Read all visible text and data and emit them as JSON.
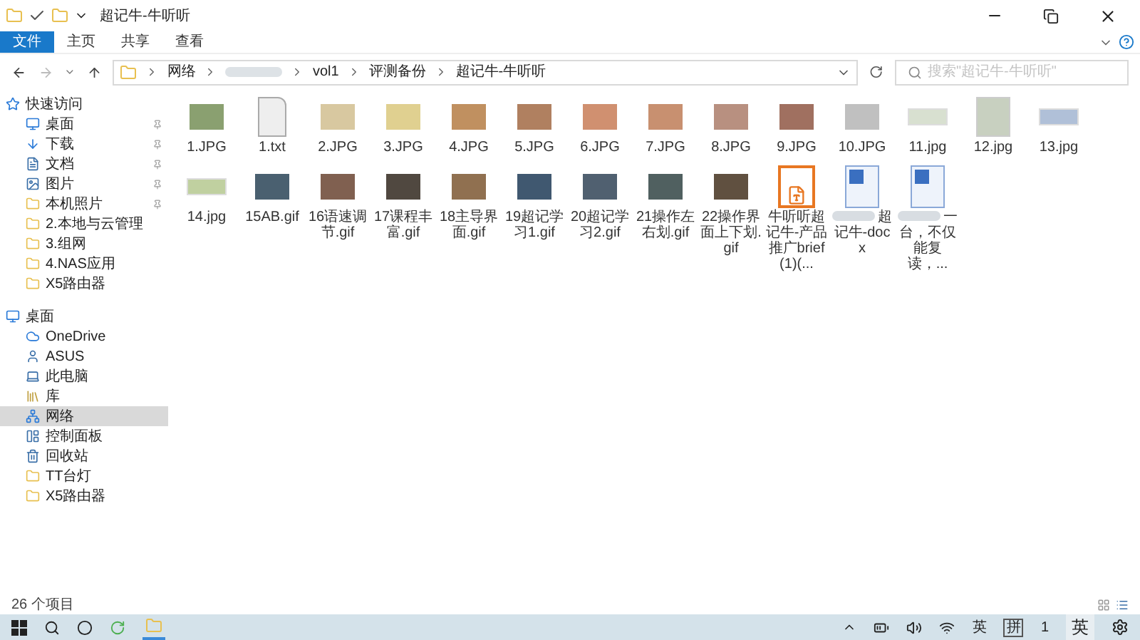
{
  "window": {
    "title": "超记牛-牛听听"
  },
  "ribbon_tabs": [
    {
      "label": "文件",
      "selected": true
    },
    {
      "label": "主页",
      "selected": false
    },
    {
      "label": "共享",
      "selected": false
    },
    {
      "label": "查看",
      "selected": false
    }
  ],
  "address": {
    "segments": [
      "网络",
      "vol1",
      "评测备份",
      "超记牛-牛听听"
    ]
  },
  "search": {
    "placeholder": "搜索\"超记牛-牛听听\""
  },
  "sidebar": {
    "items": [
      {
        "label": "快速访问",
        "kind": "star",
        "group": true,
        "pinned": false,
        "selected": false
      },
      {
        "label": "桌面",
        "kind": "desktop",
        "group": false,
        "pinned": true,
        "selected": false
      },
      {
        "label": "下载",
        "kind": "download",
        "group": false,
        "pinned": true,
        "selected": false
      },
      {
        "label": "文档",
        "kind": "document",
        "group": false,
        "pinned": true,
        "selected": false
      },
      {
        "label": "图片",
        "kind": "picture",
        "group": false,
        "pinned": true,
        "selected": false
      },
      {
        "label": "本机照片",
        "kind": "folder",
        "group": false,
        "pinned": true,
        "selected": false
      },
      {
        "label": "2.本地与云管理",
        "kind": "folder",
        "group": false,
        "pinned": false,
        "selected": false
      },
      {
        "label": "3.组网",
        "kind": "folder",
        "group": false,
        "pinned": false,
        "selected": false
      },
      {
        "label": "4.NAS应用",
        "kind": "folder",
        "group": false,
        "pinned": false,
        "selected": false
      },
      {
        "label": "X5路由器",
        "kind": "folder",
        "group": false,
        "pinned": false,
        "selected": false
      },
      {
        "label": "桌面",
        "kind": "desktop",
        "group": true,
        "pinned": false,
        "selected": false
      },
      {
        "label": "OneDrive",
        "kind": "cloud",
        "group": false,
        "pinned": false,
        "selected": false
      },
      {
        "label": "ASUS",
        "kind": "user",
        "group": false,
        "pinned": false,
        "selected": false
      },
      {
        "label": "此电脑",
        "kind": "computer",
        "group": false,
        "pinned": false,
        "selected": false
      },
      {
        "label": "库",
        "kind": "library",
        "group": false,
        "pinned": false,
        "selected": false
      },
      {
        "label": "网络",
        "kind": "network",
        "group": false,
        "pinned": false,
        "selected": true
      },
      {
        "label": "控制面板",
        "kind": "control",
        "group": false,
        "pinned": false,
        "selected": false
      },
      {
        "label": "回收站",
        "kind": "recycle",
        "group": false,
        "pinned": false,
        "selected": false
      },
      {
        "label": "TT台灯",
        "kind": "folder",
        "group": false,
        "pinned": false,
        "selected": false
      },
      {
        "label": "X5路由器",
        "kind": "folder",
        "group": false,
        "pinned": false,
        "selected": false
      }
    ]
  },
  "files": [
    {
      "name": "1.JPG",
      "kind": "photo",
      "color": "#8aa070"
    },
    {
      "name": "1.txt",
      "kind": "text",
      "color": "#eeeeee"
    },
    {
      "name": "2.JPG",
      "kind": "photo",
      "color": "#d8c8a0"
    },
    {
      "name": "3.JPG",
      "kind": "photo",
      "color": "#e0d090"
    },
    {
      "name": "4.JPG",
      "kind": "photo",
      "color": "#c09060"
    },
    {
      "name": "5.JPG",
      "kind": "photo",
      "color": "#b08060"
    },
    {
      "name": "6.JPG",
      "kind": "photo",
      "color": "#d09070"
    },
    {
      "name": "7.JPG",
      "kind": "photo",
      "color": "#c89070"
    },
    {
      "name": "8.JPG",
      "kind": "photo",
      "color": "#b89080"
    },
    {
      "name": "9.JPG",
      "kind": "photo",
      "color": "#a07060"
    },
    {
      "name": "10.JPG",
      "kind": "photo",
      "color": "#c0c0c0"
    },
    {
      "name": "11.jpg",
      "kind": "strip",
      "color": "#d8e0d0"
    },
    {
      "name": "12.jpg",
      "kind": "sheet",
      "color": "#c8d0c0"
    },
    {
      "name": "13.jpg",
      "kind": "strip",
      "color": "#b0c0d8"
    },
    {
      "name": "14.jpg",
      "kind": "strip",
      "color": "#c0d0a0"
    },
    {
      "name": "15AB.gif",
      "kind": "photo",
      "color": "#4a6070"
    },
    {
      "name": "16语速调节.gif",
      "kind": "photo",
      "color": "#806050"
    },
    {
      "name": "17课程丰富.gif",
      "kind": "photo",
      "color": "#504840"
    },
    {
      "name": "18主导界面.gif",
      "kind": "photo",
      "color": "#907050"
    },
    {
      "name": "19超记学习1.gif",
      "kind": "photo",
      "color": "#405870"
    },
    {
      "name": "20超记学习2.gif",
      "kind": "photo",
      "color": "#506070"
    },
    {
      "name": "21操作左右划.gif",
      "kind": "photo",
      "color": "#506060"
    },
    {
      "name": "22操作界面上下划.gif",
      "kind": "photo",
      "color": "#605040"
    },
    {
      "name": "牛听听超记牛-产品推广brief(1)(...",
      "kind": "pdf",
      "color": "#e87722"
    },
    {
      "name": "超记牛-docx",
      "kind": "docx",
      "color": "#3a6fc0"
    },
    {
      "name": "一台，不仅能复读，...",
      "kind": "docx",
      "color": "#3a6fc0"
    }
  ],
  "status_bar": {
    "count": "26 个项目"
  },
  "taskbar": {
    "tray": [
      "英",
      "拼",
      "1",
      "英"
    ]
  }
}
